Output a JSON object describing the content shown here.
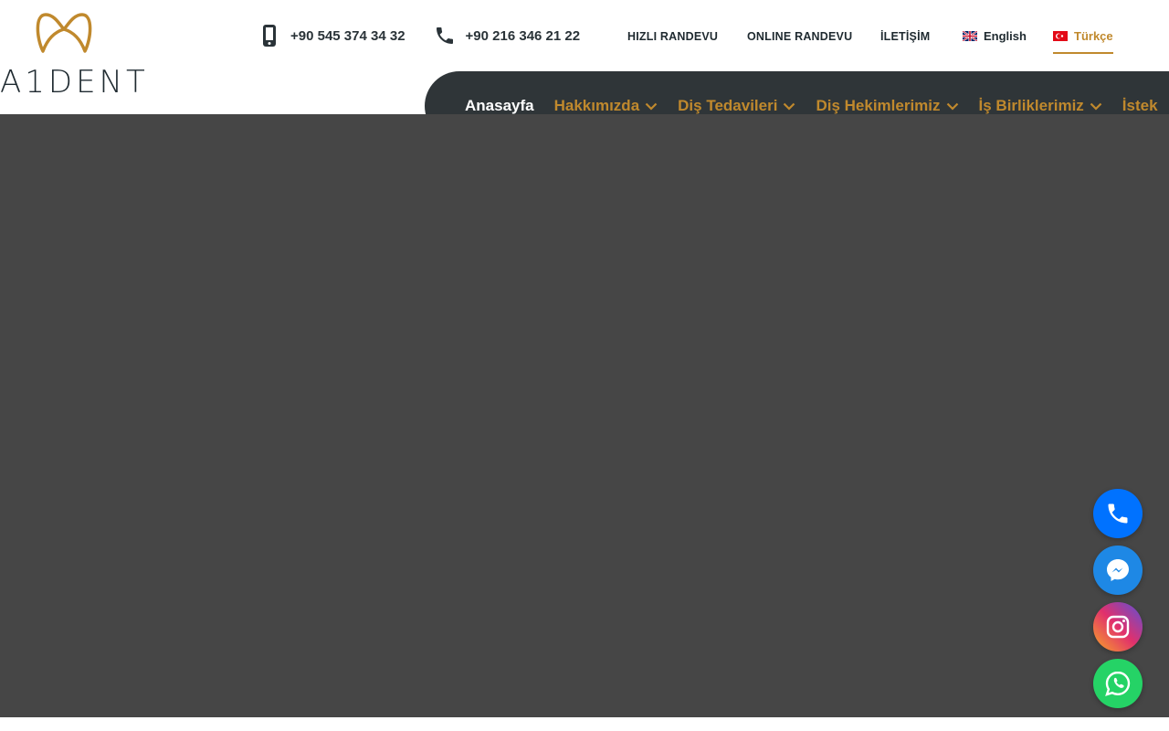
{
  "brand": {
    "name": "A1 DENT",
    "logo_text": "A1DENT",
    "colors": {
      "gold": "#c0892d",
      "dark": "#2f3538",
      "hero": "#464646"
    }
  },
  "topbar": {
    "phones": [
      {
        "icon": "mobile-phone-icon",
        "number": "+90 545 374 34 32"
      },
      {
        "icon": "phone-handset-icon",
        "number": "+90 216 346 21 22"
      }
    ],
    "links": {
      "quick_appointment": "HIZLI RANDEVU",
      "online_appointment": "ONLINE RANDEVU",
      "contact": "İLETİŞİM"
    },
    "languages": [
      {
        "label": "English",
        "icon": "uk-flag-icon",
        "active": false
      },
      {
        "label": "Türkçe",
        "icon": "turkey-flag-icon",
        "active": true
      }
    ]
  },
  "nav": {
    "items": [
      {
        "label": "Anasayfa",
        "dropdown": false
      },
      {
        "label": "Hakkımızda",
        "dropdown": true
      },
      {
        "label": "Diş Tedavileri",
        "dropdown": true
      },
      {
        "label": "Diş Hekimlerimiz",
        "dropdown": true
      },
      {
        "label": "İş Birliklerimiz",
        "dropdown": true
      },
      {
        "label": "İstek",
        "dropdown": false
      }
    ]
  },
  "floating_buttons": [
    {
      "name": "phone-call-button",
      "icon": "phone-icon",
      "color": "#0072ff"
    },
    {
      "name": "messenger-button",
      "icon": "messenger-icon",
      "color": "#1e88e5"
    },
    {
      "name": "instagram-button",
      "icon": "instagram-icon",
      "color": "#e1306c"
    },
    {
      "name": "whatsapp-button",
      "icon": "whatsapp-icon",
      "color": "#25d366"
    }
  ]
}
